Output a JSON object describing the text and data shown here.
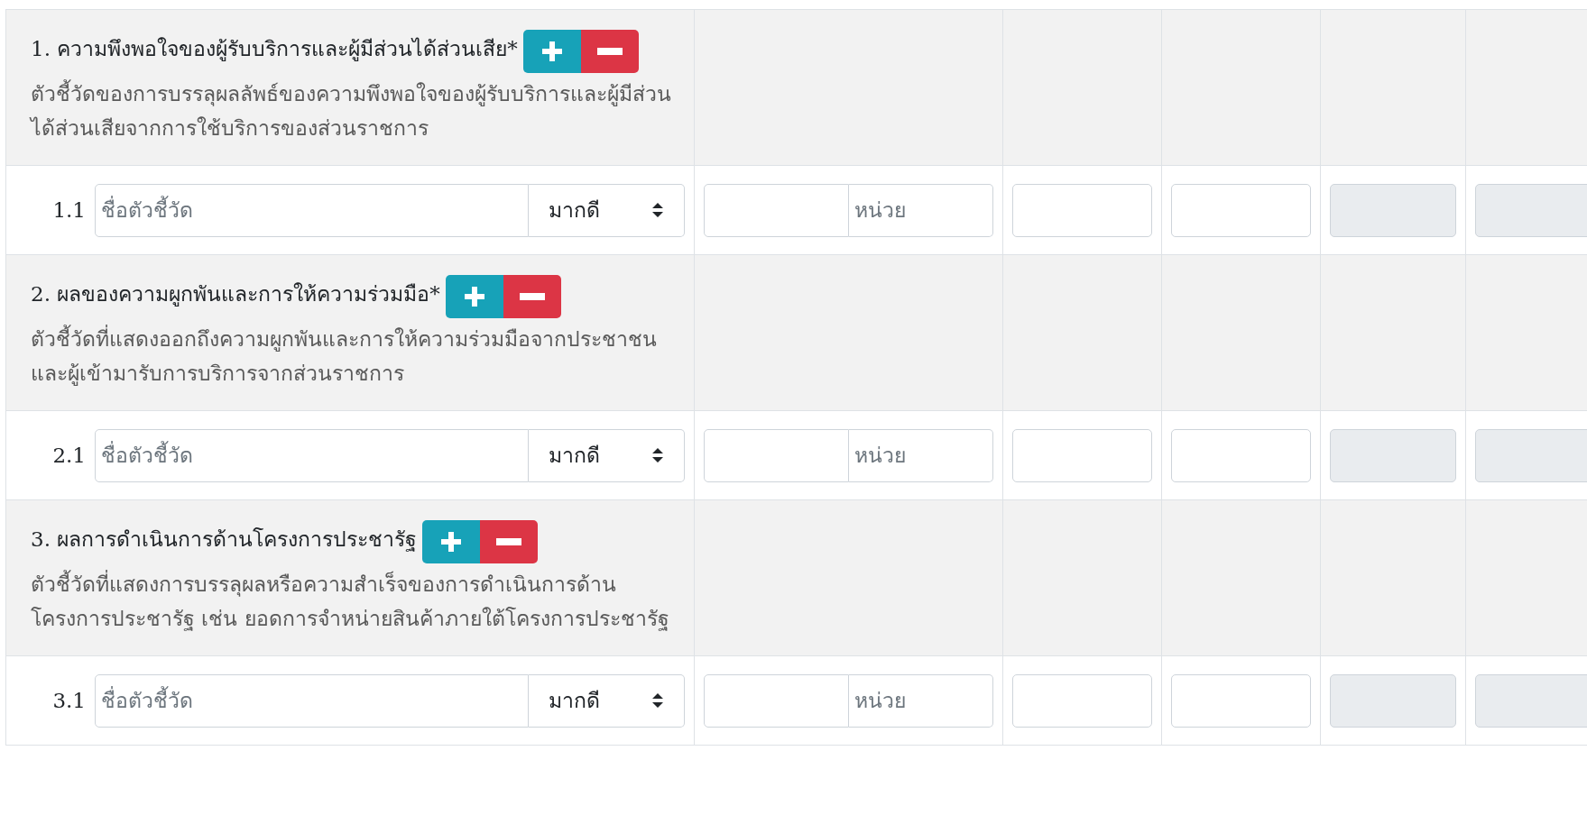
{
  "sections": [
    {
      "title": "1. ความพึงพอใจของผู้รับบริการและผู้มีส่วนได้ส่วนเสีย*",
      "description": "ตัวชี้วัดของการบรรลุผลลัพธ์ของความพึงพอใจของผู้รับบริการและผู้มีส่วนได้ส่วนเสียจากการใช้บริการของส่วนราชการ",
      "indicators": [
        {
          "number": "1.1",
          "name_placeholder": "ชื่อตัวชี้วัด",
          "direction": "มากดี",
          "unit_placeholder": "หน่วย",
          "value_fields": [
            {
              "disabled": false
            },
            {
              "disabled": false
            },
            {
              "disabled": true
            },
            {
              "disabled": true
            }
          ]
        }
      ]
    },
    {
      "title": "2. ผลของความผูกพันและการให้ความร่วมมือ*",
      "description": "ตัวชี้วัดที่แสดงออกถึงความผูกพันและการให้ความร่วมมือจากประชาชนและผู้เข้ามารับการบริการจากส่วนราชการ",
      "indicators": [
        {
          "number": "2.1",
          "name_placeholder": "ชื่อตัวชี้วัด",
          "direction": "มากดี",
          "unit_placeholder": "หน่วย",
          "value_fields": [
            {
              "disabled": false
            },
            {
              "disabled": false
            },
            {
              "disabled": true
            },
            {
              "disabled": true
            }
          ]
        }
      ]
    },
    {
      "title": "3. ผลการดำเนินการด้านโครงการประชารัฐ",
      "description": "ตัวชี้วัดที่แสดงการบรรลุผลหรือความสำเร็จของการดำเนินการด้านโครงการประชารัฐ เช่น ยอดการจำหน่ายสินค้าภายใต้โครงการประชารัฐ",
      "indicators": [
        {
          "number": "3.1",
          "name_placeholder": "ชื่อตัวชี้วัด",
          "direction": "มากดี",
          "unit_placeholder": "หน่วย",
          "value_fields": [
            {
              "disabled": false
            },
            {
              "disabled": false
            },
            {
              "disabled": true
            },
            {
              "disabled": true
            }
          ]
        }
      ]
    }
  ]
}
